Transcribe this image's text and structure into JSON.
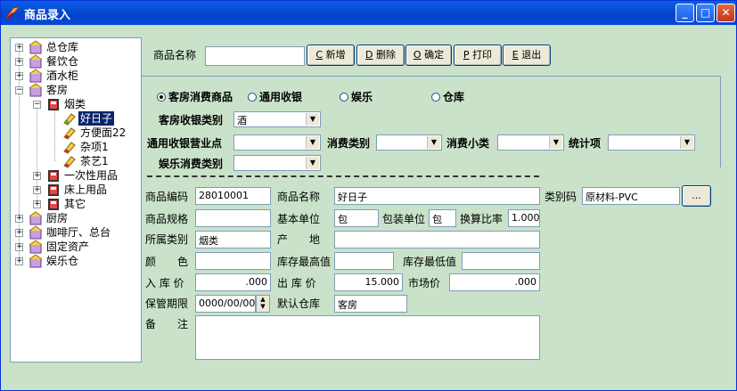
{
  "window": {
    "title": "商品录入",
    "controls": {
      "minimize": "_",
      "maximize": "□",
      "close": "✕"
    }
  },
  "tree": {
    "items": [
      {
        "label": "总仓库",
        "expanded": false
      },
      {
        "label": "餐饮仓",
        "expanded": false
      },
      {
        "label": "酒水柜",
        "expanded": false
      },
      {
        "label": "客房",
        "expanded": true
      },
      {
        "label": "烟类",
        "expanded": true
      },
      {
        "label": "好日子",
        "selected": true
      },
      {
        "label": "方便面22"
      },
      {
        "label": "杂项1"
      },
      {
        "label": "茶艺1"
      },
      {
        "label": "一次性用品",
        "expanded": false
      },
      {
        "label": "床上用品",
        "expanded": false
      },
      {
        "label": "其它",
        "expanded": false
      },
      {
        "label": "厨房",
        "expanded": false
      },
      {
        "label": "咖啡厅、总台",
        "expanded": false
      },
      {
        "label": "固定资产",
        "expanded": false
      },
      {
        "label": "娱乐仓",
        "expanded": false
      }
    ]
  },
  "toolbar": {
    "name_label": "商品名称",
    "name_value": "",
    "buttons": [
      {
        "key": "C",
        "label": "新增"
      },
      {
        "key": "D",
        "label": "删除"
      },
      {
        "key": "O",
        "label": "确定"
      },
      {
        "key": "P",
        "label": "打印"
      },
      {
        "key": "E",
        "label": "退出"
      }
    ]
  },
  "options": {
    "radios": [
      {
        "label": "客房消费商品",
        "checked": true
      },
      {
        "label": "通用收银",
        "checked": false
      },
      {
        "label": "娱乐",
        "checked": false
      },
      {
        "label": "仓库",
        "checked": false
      }
    ],
    "room_cat_label": "客房收银类别",
    "room_cat_value": "酒",
    "general_point_label": "通用收银营业点",
    "general_point_value": "",
    "consume_cat_label": "消费类别",
    "consume_cat_value": "",
    "consume_sub_label": "消费小类",
    "consume_sub_value": "",
    "stat_label": "统计项",
    "stat_value": "",
    "ent_cat_label": "娱乐消费类别",
    "ent_cat_value": ""
  },
  "form": {
    "code_label": "商品编码",
    "code_value": "28010001",
    "pname_label": "商品名称",
    "pname_value": "好日子",
    "catcode_label": "类别码",
    "catcode_value": "原材料-PVC",
    "browse_label": "...",
    "spec_label": "商品规格",
    "spec_value": "",
    "unit_label": "基本单位",
    "unit_value": "包",
    "pack_label": "包装单位",
    "pack_value": "包",
    "ratio_label": "换算比率",
    "ratio_value": "1.000",
    "belong_label": "所属类别",
    "belong_value": "烟类",
    "origin_label": "产　　地",
    "origin_value": "",
    "color_label": "颜　　色",
    "color_value": "",
    "max_label": "库存最高值",
    "max_value": "",
    "min_label": "库存最低值",
    "min_value": "",
    "in_price_label": "入 库 价",
    "in_price_value": ".000",
    "out_price_label": "出 库 价",
    "out_price_value": "15.000",
    "market_label": "市场价",
    "market_value": ".000",
    "expire_label": "保管期限",
    "expire_value": "0000/00/00",
    "default_wh_label": "默认仓库",
    "default_wh_value": "客房",
    "note_label": "备　　注",
    "note_value": ""
  }
}
